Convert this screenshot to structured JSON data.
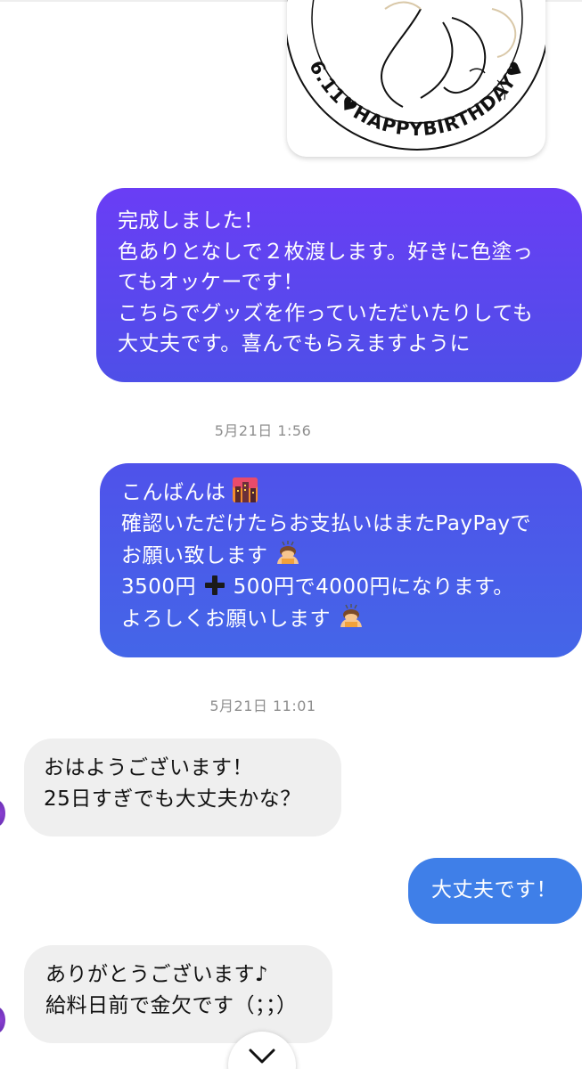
{
  "image_message": {
    "circle_text": "6.11♥HAPPYBIRTHDAY♥"
  },
  "messages": [
    {
      "direction": "outgoing",
      "lines": [
        "完成しました！",
        "色ありとなしで２枚渡します。好きに色塗っ",
        "てもオッケーです！",
        "こちらでグッズを作っていただいたりしても",
        "大丈夫です。喜んでもらえますように"
      ]
    },
    {
      "direction": "outgoing",
      "line1": "こんばんは",
      "line2": "確認いただけたらお支払いはまたPayPayで",
      "line3": "お願い致します",
      "line4a": "3500円",
      "line4b": "500円で4000円になります。",
      "line5": "よろしくお願いします"
    },
    {
      "direction": "incoming",
      "lines": [
        "おはようございます！",
        "25日すぎでも大丈夫かな？"
      ]
    },
    {
      "direction": "outgoing",
      "lines": [
        "大丈夫です！"
      ]
    },
    {
      "direction": "incoming",
      "lines": [
        "ありがとうございます♪",
        "給料日前で金欠です（；；）"
      ]
    }
  ],
  "timestamps": [
    "5月21日 1:56",
    "5月21日 11:01"
  ],
  "icons": {
    "emoji_cityscape": "sunset-cityscape-emoji",
    "emoji_bow": "person-bowing-emoji",
    "emoji_plus": "heavy-plus-emoji",
    "scroll_down": "chevron-down-icon"
  },
  "colors": {
    "bubble_1_top": "#6a3df5",
    "bubble_2": "#4f52ea",
    "bubble_4": "#3f7fe8",
    "incoming_bg": "#efefef",
    "timestamp": "#8e8e8e"
  }
}
